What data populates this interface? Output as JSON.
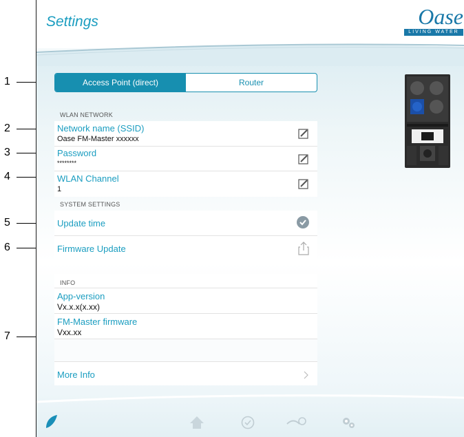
{
  "header": {
    "title": "Settings"
  },
  "logo": {
    "name": "Oase",
    "tagline": "LIVING WATER"
  },
  "mode_segment": {
    "options": [
      "Access Point (direct)",
      "Router"
    ],
    "selected": "Access Point (direct)"
  },
  "wlan": {
    "section_label": "WLAN NETWORK",
    "network_name": {
      "title": "Network name (SSID)",
      "value": "Oase FM-Master xxxxxx"
    },
    "password": {
      "title": "Password",
      "value": "********"
    },
    "channel": {
      "title": "WLAN Channel",
      "value": "1"
    }
  },
  "system": {
    "section_label": "SYSTEM SETTINGS",
    "update_time": "Update time",
    "firmware_update": "Firmware Update"
  },
  "info": {
    "section_label": "INFO",
    "app_version": {
      "title": "App-version",
      "value": "Vx.x.x(x.xx)"
    },
    "fm_firmware": {
      "title": "FM-Master firmware",
      "value": "Vxx.xx"
    },
    "more_info": "More Info"
  },
  "callouts": [
    "1",
    "2",
    "3",
    "4",
    "5",
    "6",
    "7"
  ],
  "tabbar": {
    "items": [
      "oase-leaf-icon",
      "home-icon",
      "clock-icon",
      "pond-icon",
      "gears-icon"
    ]
  },
  "colors": {
    "accent": "#1a9dc0",
    "segment": "#178fb0",
    "logo": "#1978a8"
  }
}
